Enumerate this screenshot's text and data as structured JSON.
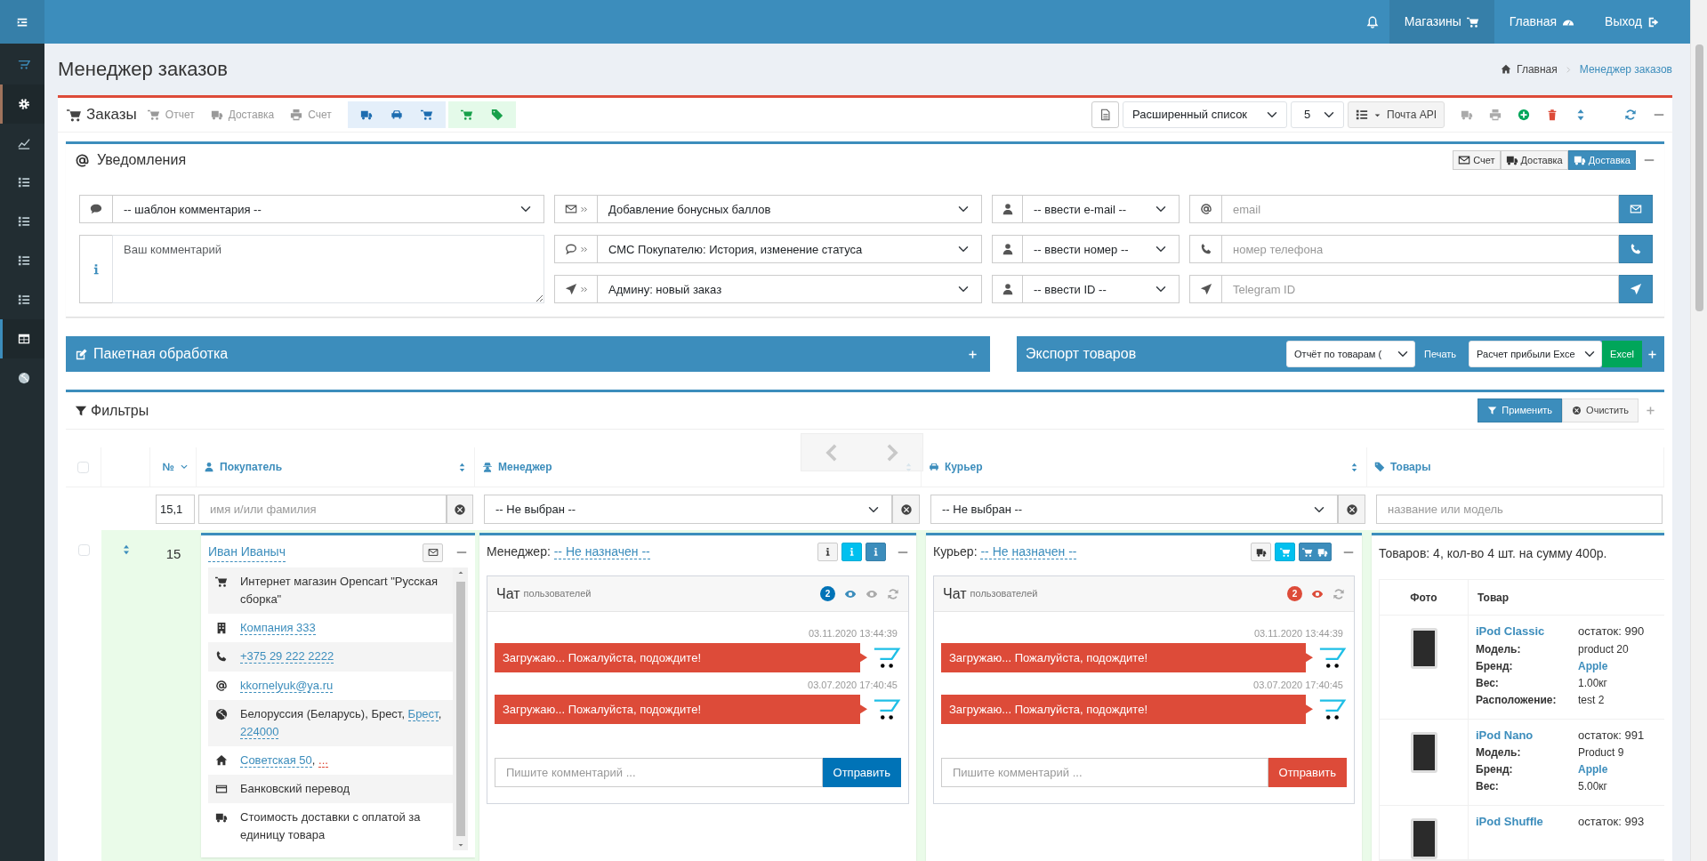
{
  "topbar": {
    "items": [
      {
        "label": "Магазины",
        "kind": "cart",
        "selected": true
      },
      {
        "label": "Главная",
        "kind": "dashboard",
        "selected": false
      },
      {
        "label": "Выход",
        "kind": "exit",
        "selected": false
      }
    ]
  },
  "sidebar": {
    "items": [
      {
        "kind": "logo",
        "selected": false
      },
      {
        "kind": "gear",
        "selected": true,
        "color": "#a0735c"
      },
      {
        "kind": "chart",
        "selected": false
      },
      {
        "kind": "list",
        "selected": false
      },
      {
        "kind": "list",
        "selected": false
      },
      {
        "kind": "list",
        "selected": false
      },
      {
        "kind": "list",
        "selected": false
      },
      {
        "kind": "table",
        "selected": true,
        "color": "#3c8dbc"
      },
      {
        "kind": "globe",
        "selected": false
      }
    ]
  },
  "page": {
    "title": "Менеджер заказов",
    "breadcrumb": [
      {
        "label": "Главная",
        "kind": "home"
      },
      {
        "label": "Менеджер заказов",
        "kind": "current"
      }
    ]
  },
  "orders": {
    "title": "Заказы",
    "links": [
      {
        "label": "Отчет",
        "kind": "cart"
      },
      {
        "label": "Доставка",
        "kind": "truck"
      },
      {
        "label": "Счет",
        "kind": "print"
      }
    ],
    "view_select": "Расширенный список",
    "count_select": "5",
    "mail_button": "Почта API"
  },
  "notifications": {
    "title": "Уведомления",
    "buttons": [
      {
        "label": "Счет",
        "kind": "envelope",
        "selected": false
      },
      {
        "label": "Доставка",
        "kind": "truck",
        "selected": false
      },
      {
        "label": "Доставка",
        "kind": "truck",
        "selected": true
      }
    ],
    "template_select": "-- шаблон комментария --",
    "comment_placeholder": "Ваш комментарий",
    "channels": [
      {
        "kind": "email",
        "template": "Добавление бонусных баллов",
        "recipient": "-- ввести e-mail --",
        "placeholder": "email"
      },
      {
        "kind": "sms",
        "template": "СМС Покупателю: История, изменение статуса",
        "recipient": "-- ввести номер --",
        "placeholder": "номер телефона"
      },
      {
        "kind": "telegram",
        "template": "Админу: новый заказ",
        "recipient": "-- ввести ID --",
        "placeholder": "Telegram ID"
      }
    ]
  },
  "batch": {
    "title": "Пакетная обработка"
  },
  "export": {
    "title": "Экспорт товаров",
    "report_select": "Отчёт по товарам (",
    "print_label": "Печать",
    "profit_select": "Расчет прибыли Exce",
    "excel_button": "Excel"
  },
  "filters": {
    "title": "Фильтры",
    "apply_button": "Применить",
    "clear_button": "Очистить"
  },
  "table": {
    "all_checked": false,
    "columns": [
      {
        "label": "№",
        "kind": "number"
      },
      {
        "label": "Покупатель",
        "kind": "customer"
      },
      {
        "label": "Менеджер",
        "kind": "manager"
      },
      {
        "label": "Курьер",
        "kind": "courier"
      },
      {
        "label": "Товары",
        "kind": "goods"
      }
    ],
    "filter_row": {
      "number": "15,1",
      "customer_placeholder": "имя и/или фамилия",
      "manager": "-- Не выбран --",
      "courier": "-- Не выбран --",
      "goods_placeholder": "название или модель"
    },
    "rows": [
      {
        "checked": false,
        "number": "15",
        "customer": {
          "name": "Иван Иваныч",
          "details": [
            {
              "kind": "cart",
              "parts": [
                {
                  "kind": "text",
                  "text": "Интернет магазин Opencart \"Русская сборка\""
                }
              ]
            },
            {
              "kind": "building",
              "parts": [
                {
                  "kind": "link",
                  "text": "Компания 333"
                }
              ]
            },
            {
              "kind": "phone",
              "parts": [
                {
                  "kind": "link",
                  "text": "+375 29 222 2222"
                }
              ]
            },
            {
              "kind": "at",
              "parts": [
                {
                  "kind": "link",
                  "text": "kkornelyuk@ya.ru"
                }
              ]
            },
            {
              "kind": "globe",
              "parts": [
                {
                  "kind": "text",
                  "text": "Белоруссия (Беларусь), Брест, "
                },
                {
                  "kind": "link",
                  "text": "Брест"
                },
                {
                  "kind": "text",
                  "text": ", "
                },
                {
                  "kind": "link",
                  "text": "224000"
                }
              ]
            },
            {
              "kind": "home",
              "parts": [
                {
                  "kind": "link",
                  "text": "Советская 50"
                },
                {
                  "kind": "text",
                  "text": ", "
                },
                {
                  "kind": "alert",
                  "text": "..."
                }
              ]
            },
            {
              "kind": "card",
              "parts": [
                {
                  "kind": "text",
                  "text": "Банковский перевод"
                }
              ]
            },
            {
              "kind": "truck",
              "parts": [
                {
                  "kind": "text",
                  "text": "Стоимость доставки с оплатой за единицу товара"
                }
              ]
            }
          ]
        },
        "manager": {
          "label": "Менеджер:",
          "value": "-- Не назначен --",
          "chat": {
            "title": "Чат",
            "subtitle": "пользователей",
            "badge": "2",
            "color": "#0073b7",
            "messages": [
              {
                "time": "03.11.2020 13:44:39",
                "text": "Загружаю... Пожалуйста, подождите!"
              },
              {
                "time": "03.07.2020 17:40:45",
                "text": "Загружаю... Пожалуйста, подождите!"
              }
            ],
            "placeholder": "Пишите комментарий ...",
            "send": "Отправить"
          }
        },
        "courier": {
          "label": "Курьер:",
          "value": "-- Не назначен --",
          "chat": {
            "title": "Чат",
            "subtitle": "пользователей",
            "badge": "2",
            "color": "#dd4b39",
            "messages": [
              {
                "time": "03.11.2020 13:44:39",
                "text": "Загружаю... Пожалуйста, подождите!"
              },
              {
                "time": "03.07.2020 17:40:45",
                "text": "Загружаю... Пожалуйста, подождите!"
              }
            ],
            "placeholder": "Пишите комментарий ...",
            "send": "Отправить"
          }
        },
        "goods": {
          "summary": "Товаров: 4, кол-во 4 шт. на сумму 400р.",
          "columns": [
            "Фото",
            "Товар"
          ],
          "products": [
            {
              "name": "iPod Classic",
              "stock": "остаток: 990",
              "specs": [
                {
                  "label": "Модель:",
                  "value": "product 20",
                  "kind": "text"
                },
                {
                  "label": "Бренд:",
                  "value": "Apple",
                  "kind": "link"
                },
                {
                  "label": "Вес:",
                  "value": "1.00кг",
                  "kind": "text"
                },
                {
                  "label": "Расположение:",
                  "value": "test 2",
                  "kind": "text"
                }
              ]
            },
            {
              "name": "iPod Nano",
              "stock": "остаток: 991",
              "specs": [
                {
                  "label": "Модель:",
                  "value": "Product 9",
                  "kind": "text"
                },
                {
                  "label": "Бренд:",
                  "value": "Apple",
                  "kind": "link"
                },
                {
                  "label": "Вес:",
                  "value": "5.00кг",
                  "kind": "text"
                }
              ]
            },
            {
              "name": "iPod Shuffle",
              "stock": "остаток: 993"
            }
          ]
        }
      }
    ]
  }
}
